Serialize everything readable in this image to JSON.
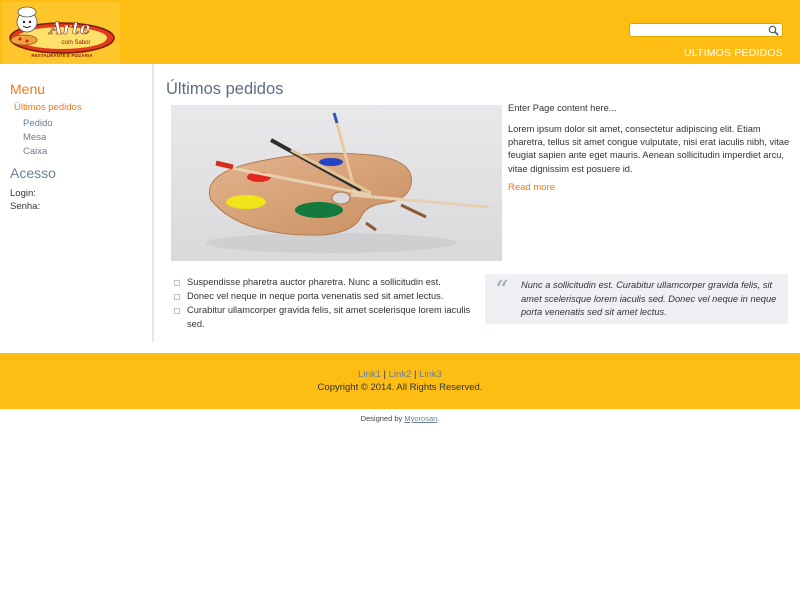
{
  "header": {
    "logo": {
      "title": "Arte",
      "subtitle": "com Sabor",
      "tagline": "RESTAURANTE E PIZZARIA"
    },
    "search": {
      "placeholder": "",
      "value": ""
    },
    "nav_label": "ÚLTIMOS PEDIDOS"
  },
  "sidebar": {
    "menu_heading": "Menu",
    "menu_items": [
      {
        "label": "Últimos pedidos",
        "active": true
      },
      {
        "label": "Pedido"
      },
      {
        "label": "Mesa"
      },
      {
        "label": "Caixa"
      }
    ],
    "acesso_heading": "Acesso",
    "login_label": "Login:",
    "senha_label": "Senha:"
  },
  "main": {
    "title": "Últimos pedidos",
    "intro": "Enter Page content here...",
    "paragraph": "Lorem ipsum dolor sit amet, consectetur adipiscing elit. Etiam pharetra, tellus sit amet congue vulputate, nisi erat iaculis nibh, vitae feugiat sapien ante eget mauris. Aenean sollicitudin imperdiet arcu, vitae dignissim est posuere id.",
    "read_more": "Read more",
    "bullets": [
      "Suspendisse pharetra auctor pharetra. Nunc a sollicitudin est.",
      "Donec vel neque in neque porta venenatis sed sit amet lectus.",
      "Curabitur ullamcorper gravida felis, sit amet scelerisque lorem iaculis sed."
    ],
    "quote": "Nunc a sollicitudin est. Curabitur ullamcorper gravida felis, sit amet scelerisque lorem iaculis sed. Donec vel neque in neque porta venenatis sed sit amet lectus."
  },
  "footer": {
    "links": [
      "Link1",
      "Link2",
      "Link3"
    ],
    "separator": " | ",
    "copyright": "Copyright © 2014. All Rights Reserved.",
    "credit_prefix": "Designed by ",
    "credit_link": "Myorosan",
    "credit_suffix": "."
  },
  "colors": {
    "header_bg": "#fdbd13",
    "accent": "#f07a1c",
    "heading": "#5a6f86",
    "quote_bg": "#eef0f3"
  }
}
